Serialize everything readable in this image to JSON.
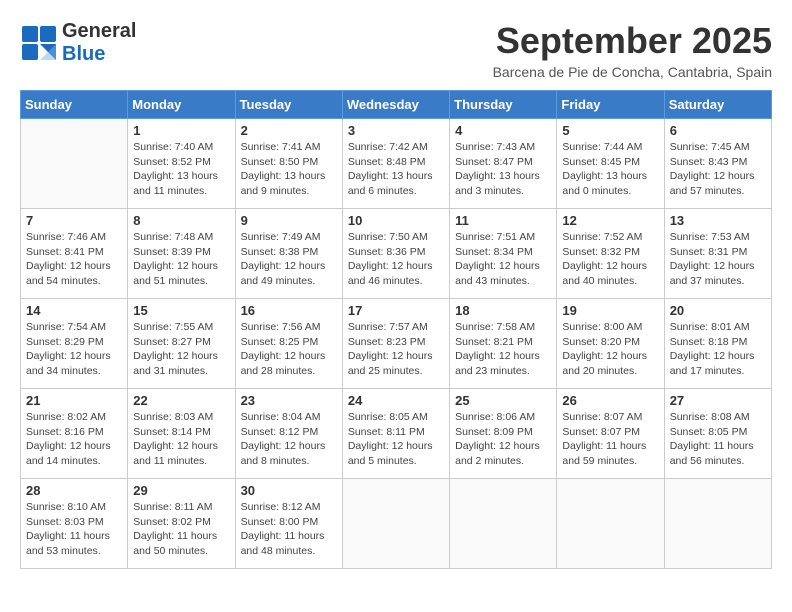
{
  "logo": {
    "part1": "General",
    "part2": "Blue"
  },
  "title": "September 2025",
  "location": "Barcena de Pie de Concha, Cantabria, Spain",
  "days_of_week": [
    "Sunday",
    "Monday",
    "Tuesday",
    "Wednesday",
    "Thursday",
    "Friday",
    "Saturday"
  ],
  "weeks": [
    [
      {
        "day": "",
        "info": ""
      },
      {
        "day": "1",
        "info": "Sunrise: 7:40 AM\nSunset: 8:52 PM\nDaylight: 13 hours\nand 11 minutes."
      },
      {
        "day": "2",
        "info": "Sunrise: 7:41 AM\nSunset: 8:50 PM\nDaylight: 13 hours\nand 9 minutes."
      },
      {
        "day": "3",
        "info": "Sunrise: 7:42 AM\nSunset: 8:48 PM\nDaylight: 13 hours\nand 6 minutes."
      },
      {
        "day": "4",
        "info": "Sunrise: 7:43 AM\nSunset: 8:47 PM\nDaylight: 13 hours\nand 3 minutes."
      },
      {
        "day": "5",
        "info": "Sunrise: 7:44 AM\nSunset: 8:45 PM\nDaylight: 13 hours\nand 0 minutes."
      },
      {
        "day": "6",
        "info": "Sunrise: 7:45 AM\nSunset: 8:43 PM\nDaylight: 12 hours\nand 57 minutes."
      }
    ],
    [
      {
        "day": "7",
        "info": "Sunrise: 7:46 AM\nSunset: 8:41 PM\nDaylight: 12 hours\nand 54 minutes."
      },
      {
        "day": "8",
        "info": "Sunrise: 7:48 AM\nSunset: 8:39 PM\nDaylight: 12 hours\nand 51 minutes."
      },
      {
        "day": "9",
        "info": "Sunrise: 7:49 AM\nSunset: 8:38 PM\nDaylight: 12 hours\nand 49 minutes."
      },
      {
        "day": "10",
        "info": "Sunrise: 7:50 AM\nSunset: 8:36 PM\nDaylight: 12 hours\nand 46 minutes."
      },
      {
        "day": "11",
        "info": "Sunrise: 7:51 AM\nSunset: 8:34 PM\nDaylight: 12 hours\nand 43 minutes."
      },
      {
        "day": "12",
        "info": "Sunrise: 7:52 AM\nSunset: 8:32 PM\nDaylight: 12 hours\nand 40 minutes."
      },
      {
        "day": "13",
        "info": "Sunrise: 7:53 AM\nSunset: 8:31 PM\nDaylight: 12 hours\nand 37 minutes."
      }
    ],
    [
      {
        "day": "14",
        "info": "Sunrise: 7:54 AM\nSunset: 8:29 PM\nDaylight: 12 hours\nand 34 minutes."
      },
      {
        "day": "15",
        "info": "Sunrise: 7:55 AM\nSunset: 8:27 PM\nDaylight: 12 hours\nand 31 minutes."
      },
      {
        "day": "16",
        "info": "Sunrise: 7:56 AM\nSunset: 8:25 PM\nDaylight: 12 hours\nand 28 minutes."
      },
      {
        "day": "17",
        "info": "Sunrise: 7:57 AM\nSunset: 8:23 PM\nDaylight: 12 hours\nand 25 minutes."
      },
      {
        "day": "18",
        "info": "Sunrise: 7:58 AM\nSunset: 8:21 PM\nDaylight: 12 hours\nand 23 minutes."
      },
      {
        "day": "19",
        "info": "Sunrise: 8:00 AM\nSunset: 8:20 PM\nDaylight: 12 hours\nand 20 minutes."
      },
      {
        "day": "20",
        "info": "Sunrise: 8:01 AM\nSunset: 8:18 PM\nDaylight: 12 hours\nand 17 minutes."
      }
    ],
    [
      {
        "day": "21",
        "info": "Sunrise: 8:02 AM\nSunset: 8:16 PM\nDaylight: 12 hours\nand 14 minutes."
      },
      {
        "day": "22",
        "info": "Sunrise: 8:03 AM\nSunset: 8:14 PM\nDaylight: 12 hours\nand 11 minutes."
      },
      {
        "day": "23",
        "info": "Sunrise: 8:04 AM\nSunset: 8:12 PM\nDaylight: 12 hours\nand 8 minutes."
      },
      {
        "day": "24",
        "info": "Sunrise: 8:05 AM\nSunset: 8:11 PM\nDaylight: 12 hours\nand 5 minutes."
      },
      {
        "day": "25",
        "info": "Sunrise: 8:06 AM\nSunset: 8:09 PM\nDaylight: 12 hours\nand 2 minutes."
      },
      {
        "day": "26",
        "info": "Sunrise: 8:07 AM\nSunset: 8:07 PM\nDaylight: 11 hours\nand 59 minutes."
      },
      {
        "day": "27",
        "info": "Sunrise: 8:08 AM\nSunset: 8:05 PM\nDaylight: 11 hours\nand 56 minutes."
      }
    ],
    [
      {
        "day": "28",
        "info": "Sunrise: 8:10 AM\nSunset: 8:03 PM\nDaylight: 11 hours\nand 53 minutes."
      },
      {
        "day": "29",
        "info": "Sunrise: 8:11 AM\nSunset: 8:02 PM\nDaylight: 11 hours\nand 50 minutes."
      },
      {
        "day": "30",
        "info": "Sunrise: 8:12 AM\nSunset: 8:00 PM\nDaylight: 11 hours\nand 48 minutes."
      },
      {
        "day": "",
        "info": ""
      },
      {
        "day": "",
        "info": ""
      },
      {
        "day": "",
        "info": ""
      },
      {
        "day": "",
        "info": ""
      }
    ]
  ]
}
